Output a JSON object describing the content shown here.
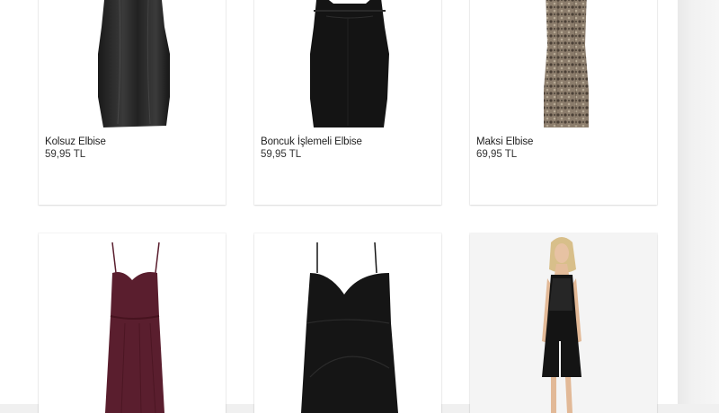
{
  "products": [
    {
      "name": "Kolsuz Elbise",
      "price": "59,95 TL",
      "image": "sleeveless-leather-dress"
    },
    {
      "name": "Boncuk İşlemeli Elbise",
      "price": "59,95 TL",
      "image": "beaded-black-dress"
    },
    {
      "name": "Maksi Elbise",
      "price": "69,95 TL",
      "image": "snake-print-maxi-dress"
    },
    {
      "name": "",
      "price": "",
      "image": "burgundy-slip-dress"
    },
    {
      "name": "",
      "price": "",
      "image": "black-strap-dress"
    },
    {
      "name": "",
      "price": "",
      "image": "model-black-leather-dress"
    }
  ],
  "colors": {
    "background": "#ffffff",
    "text": "#222222",
    "dress_black": "#151515",
    "dress_burgundy": "#5a1e2e",
    "card_photo_bg": "#f4f4f4"
  }
}
